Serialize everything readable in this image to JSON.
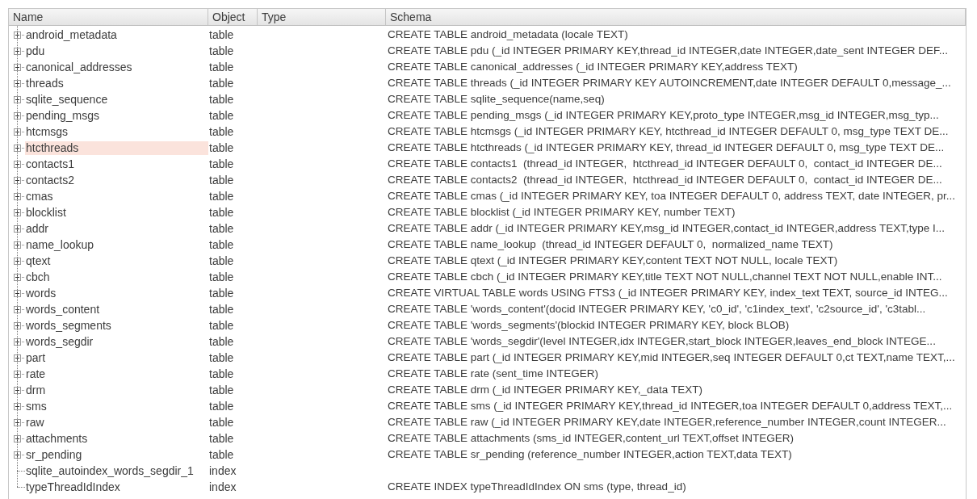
{
  "table": {
    "columns": [
      "Name",
      "Object",
      "Type",
      "Schema"
    ],
    "rows": [
      {
        "name": "android_metadata",
        "object": "table",
        "schema": "CREATE TABLE android_metadata (locale TEXT)",
        "expandable": true,
        "selected": false
      },
      {
        "name": "pdu",
        "object": "table",
        "schema": "CREATE TABLE pdu (_id INTEGER PRIMARY KEY,thread_id INTEGER,date INTEGER,date_sent INTEGER DEF...",
        "expandable": true,
        "selected": false
      },
      {
        "name": "canonical_addresses",
        "object": "table",
        "schema": "CREATE TABLE canonical_addresses (_id INTEGER PRIMARY KEY,address TEXT)",
        "expandable": true,
        "selected": false
      },
      {
        "name": "threads",
        "object": "table",
        "schema": "CREATE TABLE threads (_id INTEGER PRIMARY KEY AUTOINCREMENT,date INTEGER DEFAULT 0,message_...",
        "expandable": true,
        "selected": false
      },
      {
        "name": "sqlite_sequence",
        "object": "table",
        "schema": "CREATE TABLE sqlite_sequence(name,seq)",
        "expandable": true,
        "selected": false
      },
      {
        "name": "pending_msgs",
        "object": "table",
        "schema": "CREATE TABLE pending_msgs (_id INTEGER PRIMARY KEY,proto_type INTEGER,msg_id INTEGER,msg_typ...",
        "expandable": true,
        "selected": false
      },
      {
        "name": "htcmsgs",
        "object": "table",
        "schema": "CREATE TABLE htcmsgs (_id INTEGER PRIMARY KEY, htcthread_id INTEGER DEFAULT 0, msg_type TEXT DE...",
        "expandable": true,
        "selected": false
      },
      {
        "name": "htcthreads",
        "object": "table",
        "schema": "CREATE TABLE htcthreads (_id INTEGER PRIMARY KEY, thread_id INTEGER DEFAULT 0, msg_type TEXT DE...",
        "expandable": true,
        "selected": true
      },
      {
        "name": "contacts1",
        "object": "table",
        "schema": "CREATE TABLE contacts1  (thread_id INTEGER,  htcthread_id INTEGER DEFAULT 0,  contact_id INTEGER DE...",
        "expandable": true,
        "selected": false
      },
      {
        "name": "contacts2",
        "object": "table",
        "schema": "CREATE TABLE contacts2  (thread_id INTEGER,  htcthread_id INTEGER DEFAULT 0,  contact_id INTEGER DE...",
        "expandable": true,
        "selected": false
      },
      {
        "name": "cmas",
        "object": "table",
        "schema": "CREATE TABLE cmas (_id INTEGER PRIMARY KEY, toa INTEGER DEFAULT 0, address TEXT, date INTEGER, pr...",
        "expandable": true,
        "selected": false
      },
      {
        "name": "blocklist",
        "object": "table",
        "schema": "CREATE TABLE blocklist (_id INTEGER PRIMARY KEY, number TEXT)",
        "expandable": true,
        "selected": false
      },
      {
        "name": "addr",
        "object": "table",
        "schema": "CREATE TABLE addr (_id INTEGER PRIMARY KEY,msg_id INTEGER,contact_id INTEGER,address TEXT,type I...",
        "expandable": true,
        "selected": false
      },
      {
        "name": "name_lookup",
        "object": "table",
        "schema": "CREATE TABLE name_lookup  (thread_id INTEGER DEFAULT 0,  normalized_name TEXT)",
        "expandable": true,
        "selected": false
      },
      {
        "name": "qtext",
        "object": "table",
        "schema": "CREATE TABLE qtext (_id INTEGER PRIMARY KEY,content TEXT NOT NULL, locale TEXT)",
        "expandable": true,
        "selected": false
      },
      {
        "name": "cbch",
        "object": "table",
        "schema": "CREATE TABLE cbch (_id INTEGER PRIMARY KEY,title TEXT NOT NULL,channel TEXT NOT NULL,enable INT...",
        "expandable": true,
        "selected": false
      },
      {
        "name": "words",
        "object": "table",
        "schema": "CREATE VIRTUAL TABLE words USING FTS3 (_id INTEGER PRIMARY KEY, index_text TEXT, source_id INTEG...",
        "expandable": true,
        "selected": false
      },
      {
        "name": "words_content",
        "object": "table",
        "schema": "CREATE TABLE 'words_content'(docid INTEGER PRIMARY KEY, 'c0_id', 'c1index_text', 'c2source_id', 'c3tabl...",
        "expandable": true,
        "selected": false
      },
      {
        "name": "words_segments",
        "object": "table",
        "schema": "CREATE TABLE 'words_segments'(blockid INTEGER PRIMARY KEY, block BLOB)",
        "expandable": true,
        "selected": false
      },
      {
        "name": "words_segdir",
        "object": "table",
        "schema": "CREATE TABLE 'words_segdir'(level INTEGER,idx INTEGER,start_block INTEGER,leaves_end_block INTEGE...",
        "expandable": true,
        "selected": false
      },
      {
        "name": "part",
        "object": "table",
        "schema": "CREATE TABLE part (_id INTEGER PRIMARY KEY,mid INTEGER,seq INTEGER DEFAULT 0,ct TEXT,name TEXT,...",
        "expandable": true,
        "selected": false
      },
      {
        "name": "rate",
        "object": "table",
        "schema": "CREATE TABLE rate (sent_time INTEGER)",
        "expandable": true,
        "selected": false
      },
      {
        "name": "drm",
        "object": "table",
        "schema": "CREATE TABLE drm (_id INTEGER PRIMARY KEY,_data TEXT)",
        "expandable": true,
        "selected": false
      },
      {
        "name": "sms",
        "object": "table",
        "schema": "CREATE TABLE sms (_id INTEGER PRIMARY KEY,thread_id INTEGER,toa INTEGER DEFAULT 0,address TEXT,...",
        "expandable": true,
        "selected": false
      },
      {
        "name": "raw",
        "object": "table",
        "schema": "CREATE TABLE raw (_id INTEGER PRIMARY KEY,date INTEGER,reference_number INTEGER,count INTEGER...",
        "expandable": true,
        "selected": false
      },
      {
        "name": "attachments",
        "object": "table",
        "schema": "CREATE TABLE attachments (sms_id INTEGER,content_url TEXT,offset INTEGER)",
        "expandable": true,
        "selected": false
      },
      {
        "name": "sr_pending",
        "object": "table",
        "schema": "CREATE TABLE sr_pending (reference_number INTEGER,action TEXT,data TEXT)",
        "expandable": true,
        "selected": false
      },
      {
        "name": "sqlite_autoindex_words_segdir_1",
        "object": "index",
        "expandable": false,
        "selected": false
      },
      {
        "name": "typeThreadIdIndex",
        "object": "index",
        "schema": "CREATE INDEX typeThreadIdIndex ON sms (type, thread_id)",
        "expandable": false,
        "selected": false
      }
    ]
  }
}
